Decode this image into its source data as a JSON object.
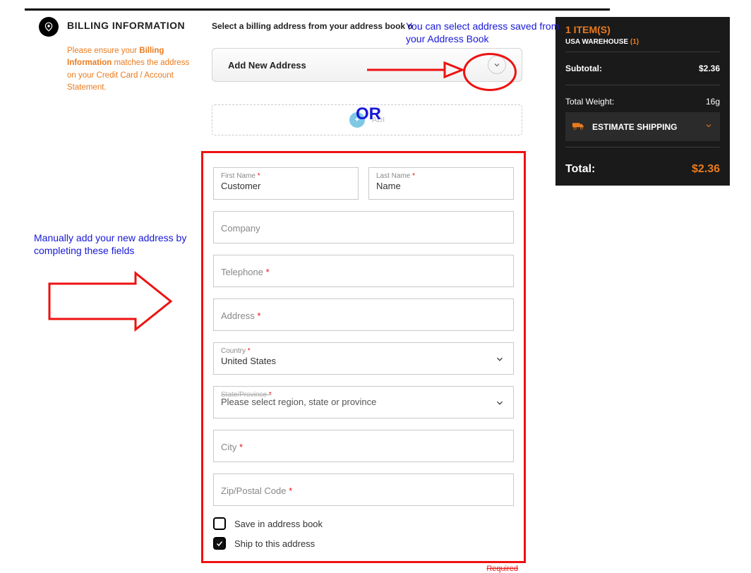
{
  "billing": {
    "heading": "BILLING INFORMATION",
    "warn_pre": "Please ensure your ",
    "warn_bold": "Billing Information",
    "warn_post": " matches the address on your Credit Card / Account Statement.",
    "select_text": "Select a billing address from your address book o"
  },
  "dropdown": {
    "label": "Add New Address"
  },
  "add_placeholder": "ADI",
  "form": {
    "first_name_label": "First Name",
    "first_name_value": "Customer",
    "last_name_label": "Last Name",
    "last_name_value": "Name",
    "company": "Company",
    "telephone": "Telephone",
    "address": "Address",
    "country_label": "Country",
    "country_value": "United States",
    "state_label": "State/Province",
    "state_ph": "Please select region, state or province",
    "city": "City",
    "zip": "Zip/Postal Code",
    "save": "Save in address book",
    "ship": "Ship to this address"
  },
  "required": "Required",
  "cart": {
    "items": "1 ITEM(S)",
    "wh_label": "USA WAREHOUSE ",
    "wh_n": "(1)",
    "subtotal_label": "Subtotal:",
    "subtotal_val": "$2.36",
    "weight_label": "Total Weight:",
    "weight_val": "16g",
    "estimate": "ESTIMATE SHIPPING",
    "total_label": "Total:",
    "total_val": "$2.36"
  },
  "annotations": {
    "top": "You can select address saved from your Address Book",
    "or": "OR",
    "left": "Manually add your new address by completing these fields"
  }
}
